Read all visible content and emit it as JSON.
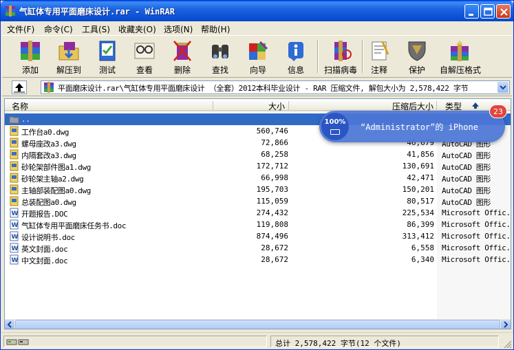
{
  "window": {
    "title": "气缸体专用平面磨床设计.rar - WinRAR"
  },
  "menu": [
    "文件(F)",
    "命令(C)",
    "工具(S)",
    "收藏夹(O)",
    "选项(N)",
    "帮助(H)"
  ],
  "toolbar": [
    {
      "label": "添加",
      "icon": "add-archive-icon"
    },
    {
      "label": "解压到",
      "icon": "extract-to-icon"
    },
    {
      "label": "测试",
      "icon": "test-icon"
    },
    {
      "label": "查看",
      "icon": "view-icon"
    },
    {
      "label": "删除",
      "icon": "delete-icon"
    },
    {
      "label": "查找",
      "icon": "find-icon"
    },
    {
      "label": "向导",
      "icon": "wizard-icon"
    },
    {
      "label": "信息",
      "icon": "info-icon"
    },
    {
      "label": "扫描病毒",
      "icon": "virus-scan-icon"
    },
    {
      "label": "注释",
      "icon": "comment-icon"
    },
    {
      "label": "保护",
      "icon": "protect-icon"
    },
    {
      "label": "自解压格式",
      "icon": "sfx-icon"
    }
  ],
  "path": {
    "text": "平面磨床设计.rar\\气缸体专用平面磨床设计 （全套）2012本科毕业设计 - RAR 压缩文件, 解包大小为 2,578,422 字节"
  },
  "columns": {
    "name": "名称",
    "size": "大小",
    "packed": "压缩后大小",
    "type": "类型"
  },
  "files": [
    {
      "name": "..",
      "size": "",
      "packed": "",
      "type": "",
      "icon": "folder-up"
    },
    {
      "name": "工作台a0.dwg",
      "size": "560,746",
      "packed": "",
      "type": "",
      "icon": "dwg"
    },
    {
      "name": "螺母座改a3.dwg",
      "size": "72,866",
      "packed": "46,679",
      "type": "AutoCAD 图形",
      "icon": "dwg"
    },
    {
      "name": "内隔套改a3.dwg",
      "size": "68,258",
      "packed": "41,856",
      "type": "AutoCAD 图形",
      "icon": "dwg"
    },
    {
      "name": "砂轮架部件图a1.dwg",
      "size": "172,712",
      "packed": "130,691",
      "type": "AutoCAD 图形",
      "icon": "dwg"
    },
    {
      "name": "砂轮架主轴a2.dwg",
      "size": "66,998",
      "packed": "42,471",
      "type": "AutoCAD 图形",
      "icon": "dwg"
    },
    {
      "name": "主轴部装配图a0.dwg",
      "size": "195,703",
      "packed": "150,201",
      "type": "AutoCAD 图形",
      "icon": "dwg"
    },
    {
      "name": "总装配图a0.dwg",
      "size": "115,059",
      "packed": "80,517",
      "type": "AutoCAD 图形",
      "icon": "dwg"
    },
    {
      "name": "开题报告.DOC",
      "size": "274,432",
      "packed": "225,534",
      "type": "Microsoft Offic...",
      "icon": "doc"
    },
    {
      "name": "气缸体专用平面磨床任务书.doc",
      "size": "119,808",
      "packed": "86,399",
      "type": "Microsoft Offic...",
      "icon": "doc"
    },
    {
      "name": "设计说明书.doc",
      "size": "874,496",
      "packed": "313,412",
      "type": "Microsoft Offic...",
      "icon": "doc"
    },
    {
      "name": "英文封面.doc",
      "size": "28,672",
      "packed": "6,558",
      "type": "Microsoft Offic...",
      "icon": "doc"
    },
    {
      "name": "中文封面.doc",
      "size": "28,672",
      "packed": "6,340",
      "type": "Microsoft Offic...",
      "icon": "doc"
    }
  ],
  "status": {
    "right": "总计 2,578,422 字节(12 个文件)"
  },
  "notification": {
    "percent": "100%",
    "message": "“Administrator”的 iPhone",
    "badge": "23"
  },
  "colors": {
    "title_blue": "#0A4FD6",
    "selection": "#316AC5",
    "notify_bg": "#4C76D6",
    "badge_red": "#E0453E"
  }
}
